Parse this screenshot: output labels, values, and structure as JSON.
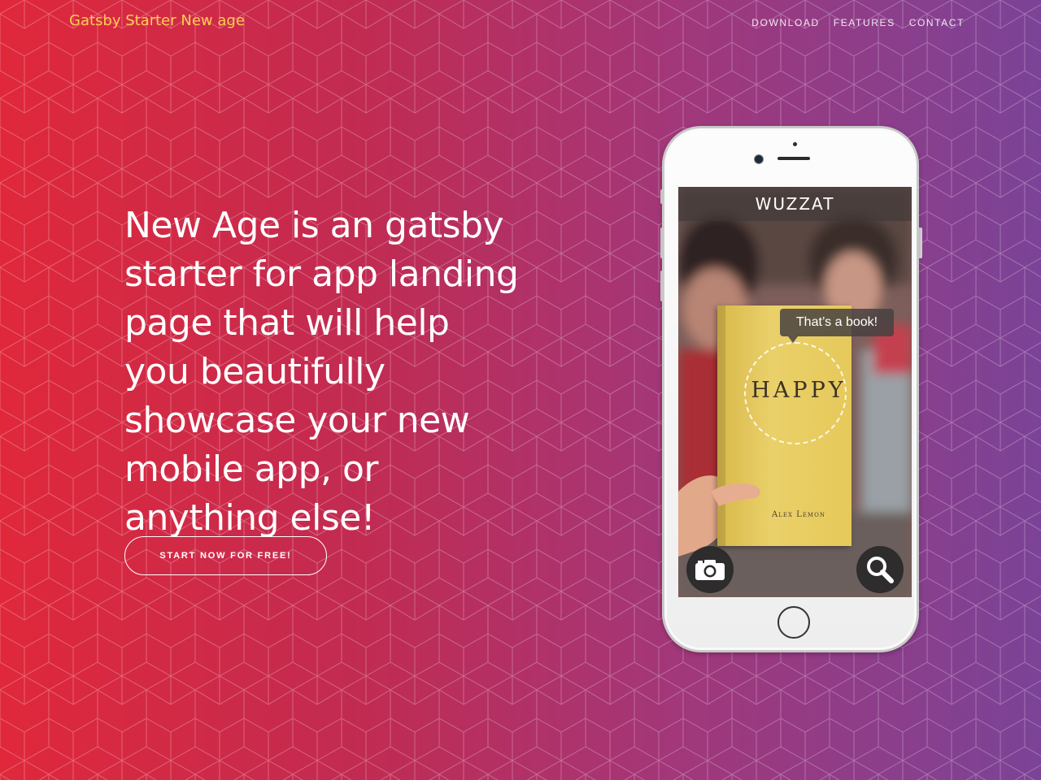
{
  "navbar": {
    "brand": "Gatsby Starter New age",
    "links": [
      "DOWNLOAD",
      "FEATURES",
      "CONTACT"
    ]
  },
  "hero": {
    "headline": "New Age is an gatsby starter for app landing page that will help you beautifully showcase your new mobile app, or anything else!",
    "cta_label": "START NOW FOR FREE!"
  },
  "phone_screen": {
    "app_title": "WUZZAT",
    "bubble_text": "That’s a book!",
    "book_title": "HAPPY",
    "book_author": "Alex Lemon",
    "left_icon": "camera-icon",
    "right_icon": "search-icon"
  },
  "colors": {
    "brand": "#fdcc52",
    "gradient_start": "#e0283a",
    "gradient_end": "#7b4397",
    "text": "#ffffff"
  }
}
